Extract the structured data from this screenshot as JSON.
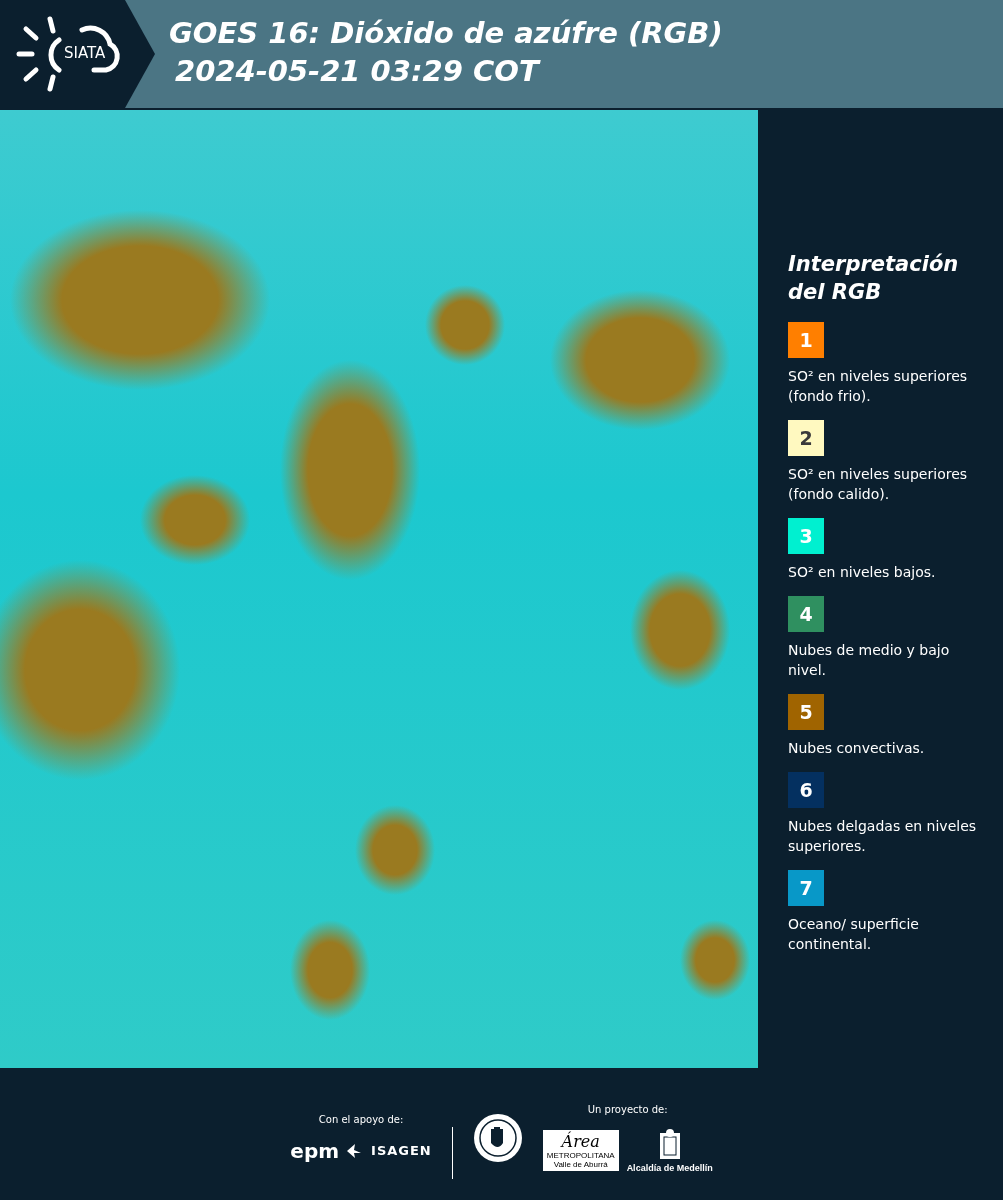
{
  "header": {
    "logo_text": "SIATA",
    "title_lines": [
      "GOES 16: Dióxido de azúfre (RGB)",
      "2024-05-21 03:29 COT"
    ]
  },
  "legend": {
    "title_lines": [
      "Interpretación",
      "del RGB"
    ],
    "items": [
      {
        "number": "1",
        "color": "#ff7f00",
        "text": "SO² en niveles superiores (fondo frio)."
      },
      {
        "number": "2",
        "color": "#fff9c0",
        "text": "SO² en niveles superiores (fondo calido)."
      },
      {
        "number": "3",
        "color": "#00f0d0",
        "text": "SO² en niveles bajos."
      },
      {
        "number": "4",
        "color": "#2f9060",
        "text": "Nubes de medio y bajo nivel."
      },
      {
        "number": "5",
        "color": "#a06400",
        "text": "Nubes convectivas."
      },
      {
        "number": "6",
        "color": "#043060",
        "text": "Nubes delgadas en niveles superiores."
      },
      {
        "number": "7",
        "color": "#0898c8",
        "text": "Oceano/ superficie continental."
      }
    ]
  },
  "footer": {
    "support_label": "Con el apoyo de:",
    "support_logos": [
      "epm",
      "ISAGEN"
    ],
    "project_label": "Un proyecto de:",
    "area_logo": {
      "title": "Área",
      "line_1": "METROPOLITANA",
      "line_2": "Valle de Aburrá"
    },
    "alcaldia_logo": "Alcaldía de Medellín"
  }
}
